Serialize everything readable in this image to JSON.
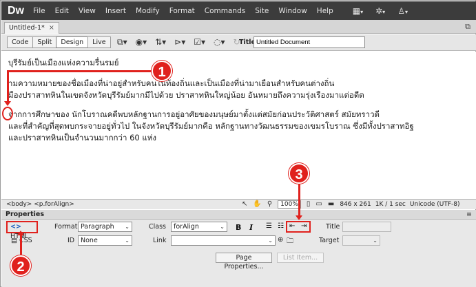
{
  "app": {
    "logo": "Dw"
  },
  "menu": [
    "File",
    "Edit",
    "View",
    "Insert",
    "Modify",
    "Format",
    "Commands",
    "Site",
    "Window",
    "Help"
  ],
  "document_tab": {
    "label": "Untitled-1*",
    "close": "×"
  },
  "toolbar": {
    "views": [
      "Code",
      "Split",
      "Design",
      "Live"
    ],
    "active_view": "Design",
    "title_label": "Title:",
    "title_value": "Untitled Document"
  },
  "content": {
    "heading": "บุรีรัมย์เป็นเมืองแห่งความรื่นรมย์",
    "para1_line1": "ามความหมายของชื่อเมืองที่น่าอยู่สำหรับคนในท้องถิ่นและเป็นเมืองที่น่ามาเยือนสำหรับคนต่างถิ่น",
    "para1_line2": "มืองปราสาทหินในเขตจังหวัดบุรีรัมย์มากมีไปด้วย ปราสาทหินใหญ่น้อย อันหมายถึงความรุ่งเรืองมาแต่อดีต",
    "para2_line1": "จากการศึกษาของ  นักโบราณคดีพบหลักฐานการอยู่อาศัยของมนุษย์มาตั้งแต่สมัยก่อนประวัติศาสตร์ สมัยทราวดี",
    "para2_line2": "และที่สำคัญที่สุดพบกระจายอยู่ทั่วไป  ในจังหวัดบุรีรัมย์มากคือ หลักฐานทางวัฒนธรรมของเขมรโบราณ ซึ่งมีทั้งปราสาทอิฐ",
    "para2_line3": "และปราสาทหินเป็นจำนวนมากกว่า 60 แห่ง"
  },
  "statusbar": {
    "tag_selector": "<body> <p.forAlign>",
    "zoom": "100%",
    "dimensions": "846 x 261",
    "download": "1K / 1 sec",
    "encoding": "Unicode (UTF-8)"
  },
  "properties": {
    "title": "Properties",
    "html_tab": "HTML",
    "css_tab": "CSS",
    "format_label": "Format",
    "format_value": "Paragraph",
    "id_label": "ID",
    "id_value": "None",
    "class_label": "Class",
    "class_value": "forAlign",
    "link_label": "Link",
    "link_value": "",
    "bold": "B",
    "italic": "I",
    "title_label": "Title",
    "target_label": "Target",
    "page_properties": "Page Properties...",
    "list_item": "List Item..."
  },
  "annotations": [
    "1",
    "2",
    "3"
  ],
  "colors": {
    "menubar": "#3c3c3c",
    "annotation": "#e0211d"
  }
}
